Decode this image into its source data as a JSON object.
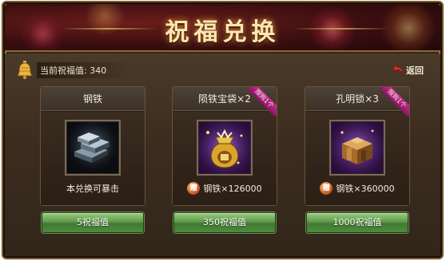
{
  "title": "祝福兑换",
  "points": {
    "label": "当前祝福值:",
    "value": "340"
  },
  "back_label": "返回",
  "colors": {
    "title_gold": "#fbe6b7",
    "button_green": "#5f9a4a",
    "ribbon_pink": "#c4308a"
  },
  "cards": [
    {
      "name": "钢铁",
      "icon": "steel-ingot-icon",
      "note": "本兑换可暴击",
      "limited": false,
      "button": "5祝福值"
    },
    {
      "name": "陨铁宝袋×2",
      "icon": "meteor-iron-bag-icon",
      "limited": true,
      "ribbon": "限购1个",
      "gift_icon": "赠",
      "gift": "钢铁×126000",
      "button": "350祝福值"
    },
    {
      "name": "孔明锁×3",
      "icon": "kongming-lock-icon",
      "limited": true,
      "ribbon": "限购1个",
      "gift_icon": "赠",
      "gift": "钢铁×360000",
      "button": "1000祝福值"
    }
  ]
}
